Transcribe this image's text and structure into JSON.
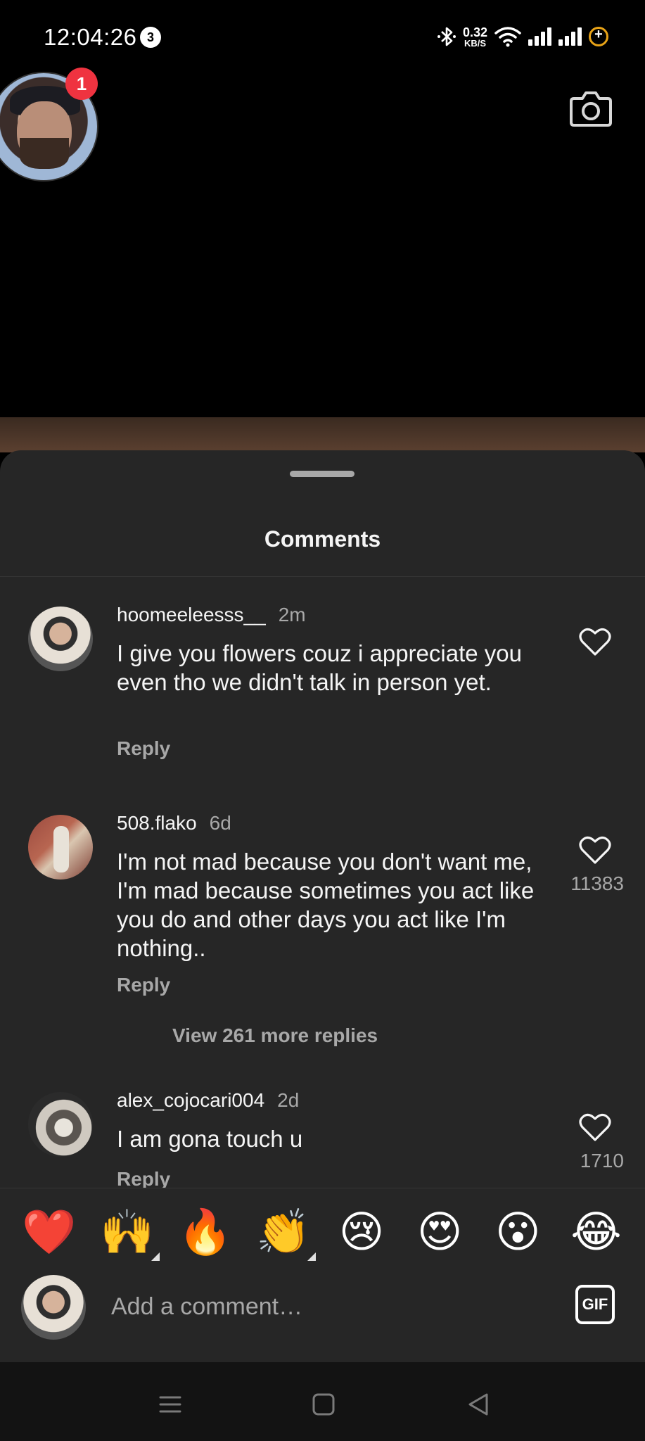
{
  "status_bar": {
    "time": "12:04:26",
    "notification_count": "3",
    "net_speed_value": "0.32",
    "net_speed_unit": "KB/S"
  },
  "story": {
    "badge_count": "1"
  },
  "sheet": {
    "title": "Comments"
  },
  "comments": [
    {
      "username": "hoomeeleesss__",
      "time": "2m",
      "text": "I give you flowers couz i appreciate you even tho we didn't talk in person yet.",
      "reply_label": "Reply",
      "likes": ""
    },
    {
      "username": "508.flako",
      "time": "6d",
      "text": "I'm not mad because you don't want me, I'm mad because sometimes you act like you do and other days you act like I'm nothing..",
      "reply_label": "Reply",
      "likes": "11383",
      "view_replies": "View 261 more replies"
    },
    {
      "username": "alex_cojocari004",
      "time": "2d",
      "text": "I am gona touch u",
      "reply_label": "Reply",
      "likes": "1710"
    }
  ],
  "emoji_bar": [
    "❤️",
    "🙌",
    "🔥",
    "👏",
    "😢",
    "😍",
    "😮",
    "😂"
  ],
  "input": {
    "placeholder": "Add a comment…",
    "gif_label": "GIF"
  },
  "colors": {
    "sheet_bg": "#262626",
    "secondary_text": "#a8a8a8",
    "badge_red": "#ef3340"
  }
}
